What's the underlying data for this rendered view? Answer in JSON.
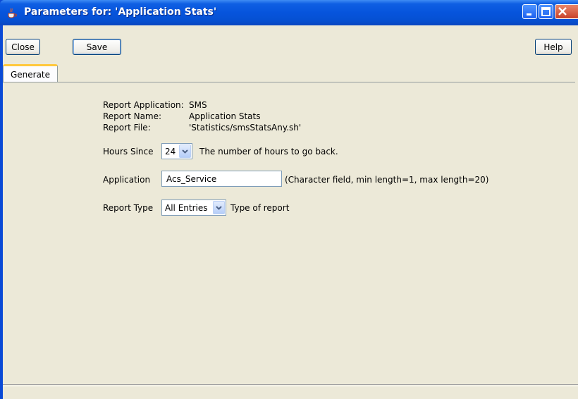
{
  "window": {
    "title": "Parameters for: 'Application Stats'",
    "icon": "java-cup-icon"
  },
  "toolbar": {
    "close_label": "Close",
    "save_label": "Save",
    "help_label": "Help"
  },
  "tabs": [
    {
      "label": "Generate",
      "selected": true
    }
  ],
  "report_info": {
    "application_label": "Report Application:",
    "application_value": "SMS",
    "name_label": "Report Name:",
    "name_value": "Application Stats",
    "file_label": "Report File:",
    "file_value": "'Statistics/smsStatsAny.sh'"
  },
  "params": {
    "hours_since": {
      "label": "Hours Since",
      "value": "24",
      "description": "The number of hours to go back."
    },
    "application": {
      "label": "Application",
      "value": "Acs_Service",
      "description": "(Character field, min length=1, max length=20)"
    },
    "report_type": {
      "label": "Report Type",
      "value": "All Entries",
      "description": "Type of report"
    }
  },
  "colors": {
    "titlebar": "#0654dc",
    "client_bg": "#ece9d8",
    "tab_highlight": "#ffc83c"
  }
}
